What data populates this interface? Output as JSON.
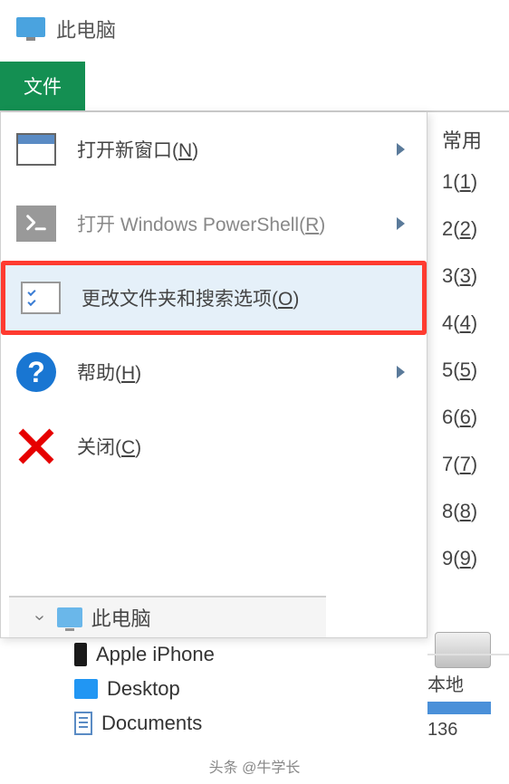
{
  "window": {
    "title": "此电脑"
  },
  "tab": {
    "label": "文件"
  },
  "menu": {
    "items": [
      {
        "label_pre": "打开新窗口(",
        "hotkey": "N",
        "label_post": ")",
        "has_submenu": true
      },
      {
        "label_pre": "打开 Windows PowerShell(",
        "hotkey": "R",
        "label_post": ")",
        "has_submenu": true
      },
      {
        "label_pre": "更改文件夹和搜索选项(",
        "hotkey": "O",
        "label_post": ")",
        "has_submenu": false
      },
      {
        "label_pre": "帮助(",
        "hotkey": "H",
        "label_post": ")",
        "has_submenu": true
      },
      {
        "label_pre": "关闭(",
        "hotkey": "C",
        "label_post": ")",
        "has_submenu": false
      }
    ]
  },
  "side": {
    "header": "常用",
    "items": [
      {
        "pre": "1(",
        "u": "1",
        "post": ")"
      },
      {
        "pre": "2(",
        "u": "2",
        "post": ")"
      },
      {
        "pre": "3(",
        "u": "3",
        "post": ")"
      },
      {
        "pre": "4(",
        "u": "4",
        "post": ")"
      },
      {
        "pre": "5(",
        "u": "5",
        "post": ")"
      },
      {
        "pre": "6(",
        "u": "6",
        "post": ")"
      },
      {
        "pre": "7(",
        "u": "7",
        "post": ")"
      },
      {
        "pre": "8(",
        "u": "8",
        "post": ")"
      },
      {
        "pre": "9(",
        "u": "9",
        "post": ")"
      }
    ]
  },
  "tree": {
    "pc": "此电脑",
    "items": [
      "Apple iPhone",
      "Desktop",
      "Documents"
    ]
  },
  "disk": {
    "label": "本地",
    "value": "136"
  },
  "watermark": "头条 @牛学长"
}
